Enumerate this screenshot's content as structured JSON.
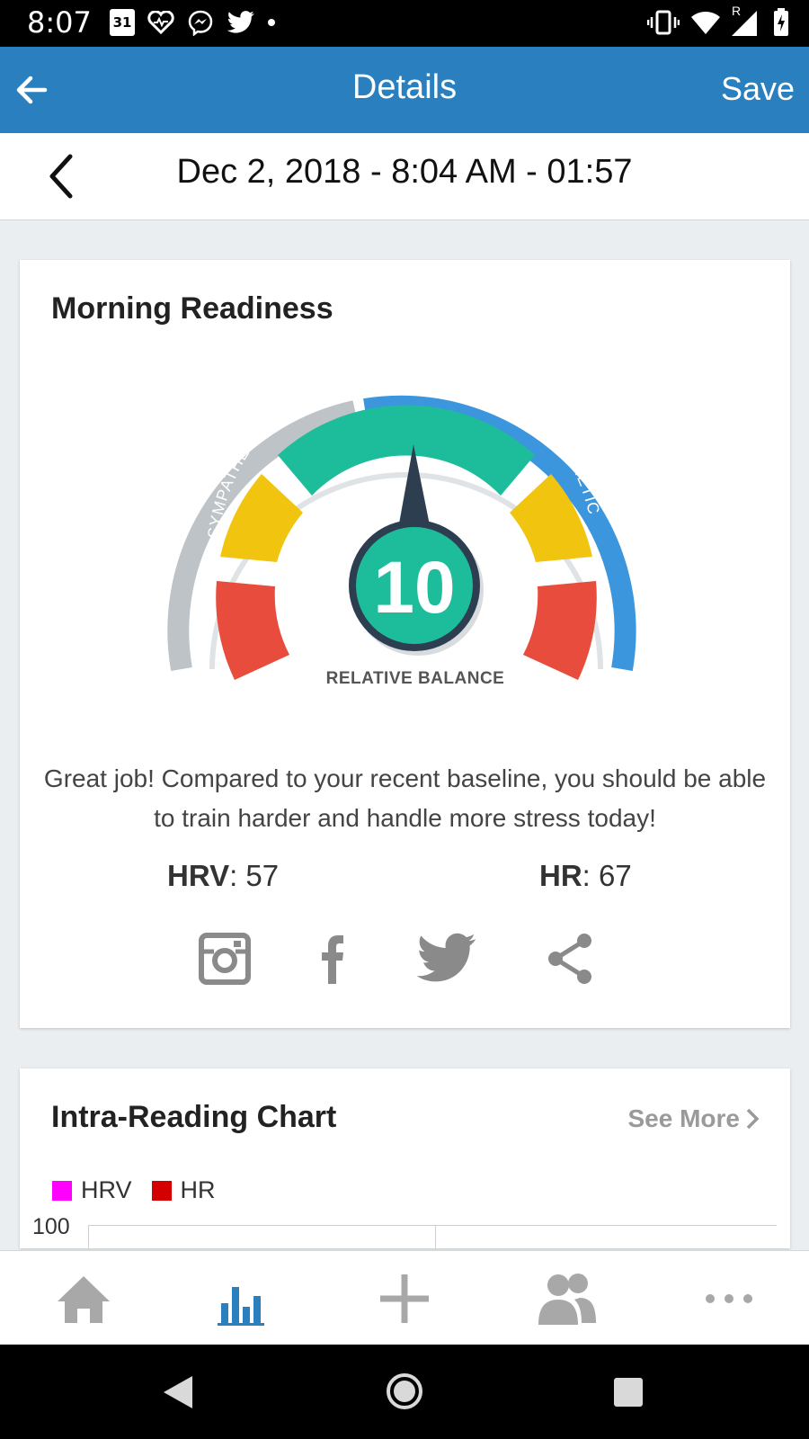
{
  "status_bar": {
    "time": "8:07",
    "calendar_day": "31",
    "signal_label": "R"
  },
  "app_bar": {
    "title": "Details",
    "save_label": "Save"
  },
  "date_bar": {
    "date_text": "Dec 2, 2018 - 8:04 AM - 01:57"
  },
  "readiness_card": {
    "title": "Morning  Readiness",
    "gauge": {
      "score": "10",
      "left_label": "SYMPATHETIC",
      "right_label": "PARASYMPATHETIC",
      "bottom_label": "RELATIVE BALANCE"
    },
    "message": "Great job! Compared to your recent baseline, you should be able to train harder and handle more stress today!",
    "hrv_label": "HRV",
    "hrv_value": ": 57",
    "hr_label": "HR",
    "hr_value": ": 67",
    "share_icons": [
      "instagram-icon",
      "facebook-icon",
      "twitter-icon",
      "share-icon"
    ]
  },
  "chart_card": {
    "title": "Intra-Reading Chart",
    "see_more_label": "See More",
    "legend": [
      {
        "label": "HRV",
        "color": "#ff00ff"
      },
      {
        "label": "HR",
        "color": "#d40000"
      }
    ],
    "y_axis_top": "100"
  },
  "bottom_nav": {
    "items": [
      "home-icon",
      "stats-icon",
      "add-icon",
      "community-icon",
      "more-icon"
    ],
    "active": "stats-icon",
    "active_color": "#2a80be",
    "inactive_color": "#a8a8a8"
  },
  "colors": {
    "app_bar": "#2a80be",
    "gauge_green": "#1dbd9c",
    "gauge_yellow": "#f1c40f",
    "gauge_red": "#e74c3c",
    "parasympathetic": "#3b96dd",
    "sympathetic": "#bdc3c7"
  }
}
